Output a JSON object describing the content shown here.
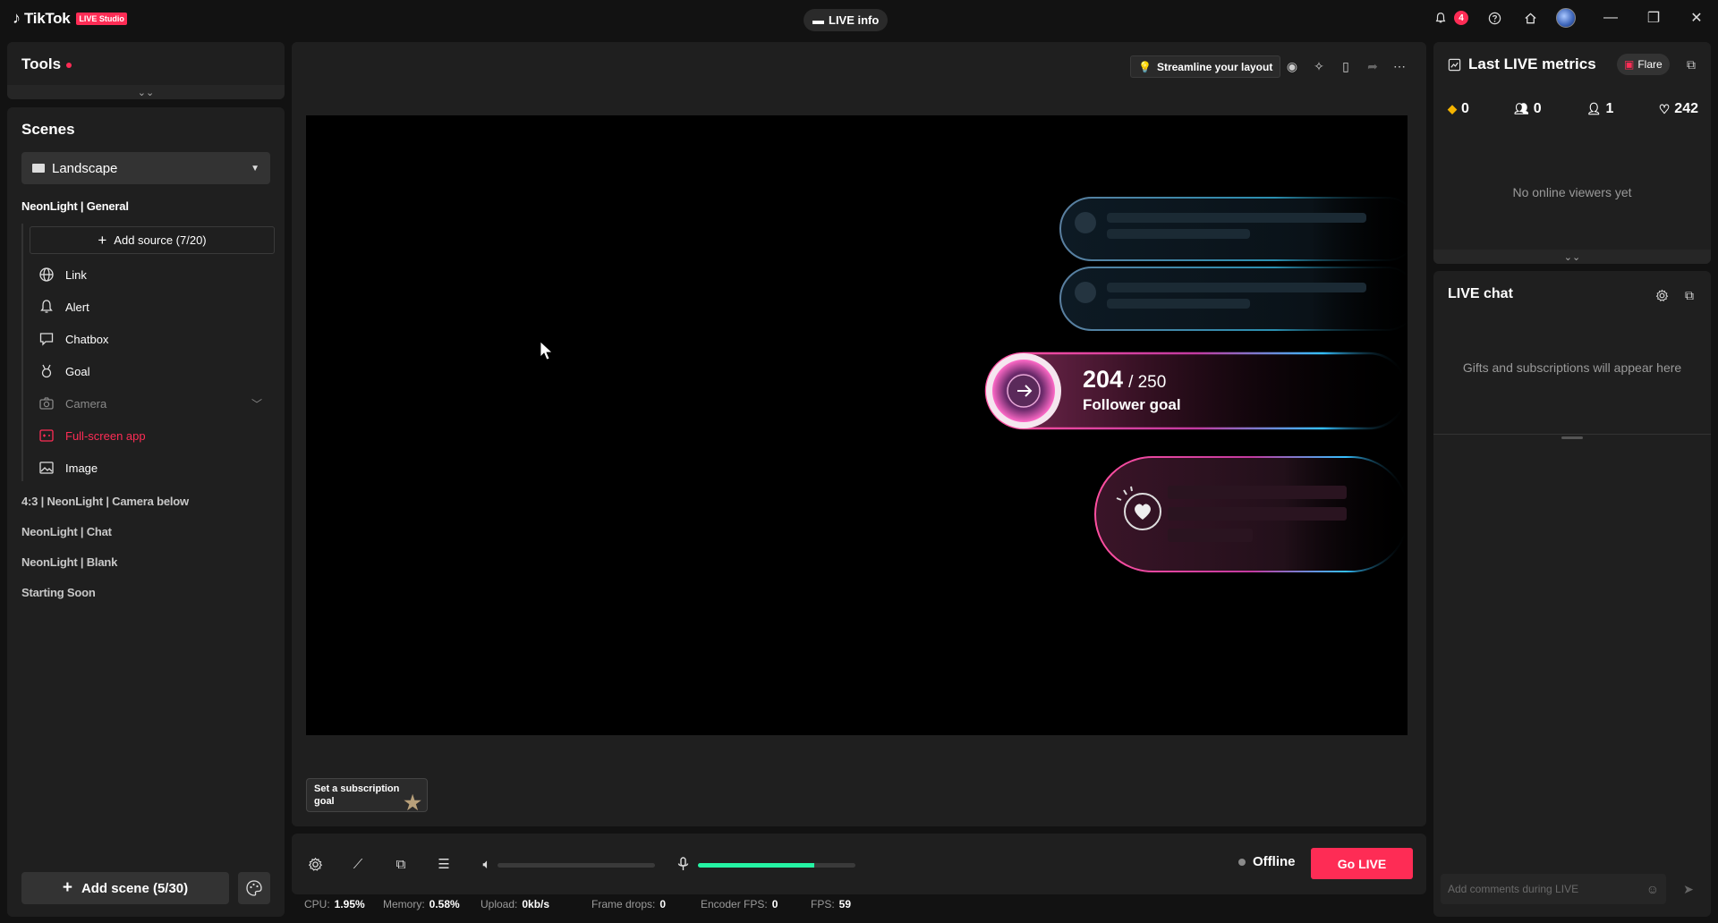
{
  "app": {
    "logo_text": "TikTok",
    "logo_badge": "LIVE Studio",
    "live_info_label": "LIVE info",
    "notification_count": "4"
  },
  "tools": {
    "title": "Tools"
  },
  "scenes": {
    "title": "Scenes",
    "orientation": "Landscape",
    "active_group": "NeonLight | General",
    "add_source_label": "Add source (7/20)",
    "sources": [
      {
        "label": "Link",
        "icon": "globe-icon",
        "state": "normal"
      },
      {
        "label": "Alert",
        "icon": "bell-icon",
        "state": "normal"
      },
      {
        "label": "Chatbox",
        "icon": "chat-icon",
        "state": "normal"
      },
      {
        "label": "Goal",
        "icon": "medal-icon",
        "state": "normal"
      },
      {
        "label": "Camera",
        "icon": "camera-icon",
        "state": "muted"
      },
      {
        "label": "Full-screen app",
        "icon": "gamepad-icon",
        "state": "active"
      },
      {
        "label": "Image",
        "icon": "image-icon",
        "state": "normal"
      }
    ],
    "other_groups": [
      "4:3 | NeonLight | Camera below",
      "NeonLight | Chat",
      "NeonLight | Blank",
      "Starting Soon"
    ],
    "add_scene_label": "Add scene (5/30)"
  },
  "preview": {
    "streamline_label": "Streamline your layout",
    "follower_current": "204",
    "follower_target": "/ 250",
    "follower_label": "Follower goal",
    "subscription_goal_label": "Set a subscription goal"
  },
  "controls": {
    "volume_level": 0,
    "mic_level": 0.74,
    "status_label": "Offline",
    "go_live_label": "Go LIVE"
  },
  "stats": {
    "cpu_label": "CPU:",
    "cpu_value": "1.95%",
    "memory_label": "Memory:",
    "memory_value": "0.58%",
    "upload_label": "Upload:",
    "upload_value": "0kb/s",
    "frame_drops_label": "Frame drops:",
    "frame_drops_value": "0",
    "encoder_fps_label": "Encoder FPS:",
    "encoder_fps_value": "0",
    "fps_label": "FPS:",
    "fps_value": "59"
  },
  "metrics": {
    "title": "Last LIVE metrics",
    "flare_label": "Flare",
    "diamonds": "0",
    "viewers": "0",
    "new_followers": "1",
    "likes": "242",
    "empty_message": "No online viewers yet"
  },
  "chat": {
    "title": "LIVE chat",
    "empty_message": "Gifts and subscriptions will appear here",
    "input_placeholder": "Add comments during LIVE"
  },
  "colors": {
    "accent": "#fe2c55",
    "mic": "#25f4a4",
    "panel": "#1f1f1f",
    "background": "#121212"
  }
}
